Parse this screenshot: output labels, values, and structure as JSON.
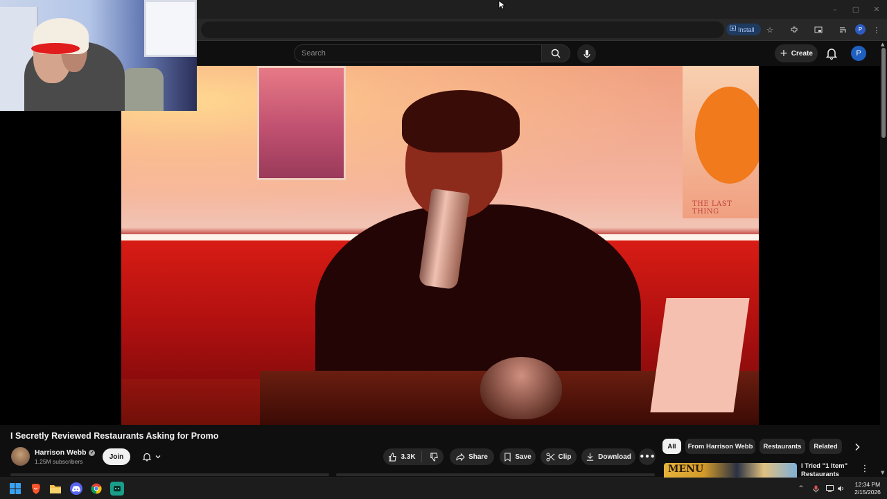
{
  "browser": {
    "install_label": "Install",
    "profile_initial": "P",
    "window_controls": [
      "–",
      "▢",
      "✕"
    ]
  },
  "header": {
    "search_placeholder": "Search",
    "create_label": "Create",
    "avatar_initial": "P"
  },
  "video": {
    "title": "I Secretly Reviewed Restaurants Asking for Promo",
    "poster_caption": "THE LAST THING"
  },
  "channel": {
    "name": "Harrison Webb",
    "subscribers": "1.25M subscribers",
    "join_label": "Join"
  },
  "actions": {
    "like_count": "3.3K",
    "share_label": "Share",
    "save_label": "Save",
    "clip_label": "Clip",
    "download_label": "Download"
  },
  "chips": [
    "All",
    "From Harrison Webb",
    "Restaurants",
    "Related"
  ],
  "recommendation": {
    "thumb_text": "MENU",
    "title": "I Tried \"1 Item\" Restaurants"
  },
  "taskbar": {
    "time": "12:34 PM",
    "date": "2/15/2026"
  },
  "colors": {
    "accent_blue": "#1f5fbf",
    "background": "#0f0f0f",
    "pill": "#272727",
    "brave_orange": "#fb542b",
    "discord": "#5865f2"
  }
}
